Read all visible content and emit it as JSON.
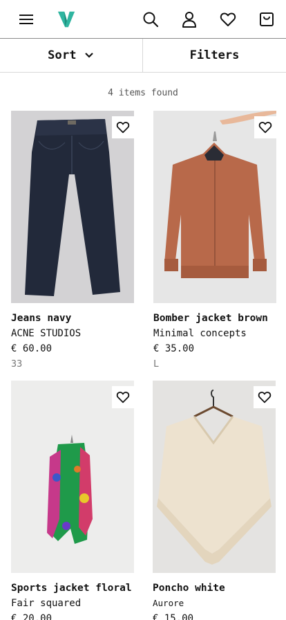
{
  "header": {
    "icons": [
      "menu-icon",
      "brand-logo",
      "search-icon",
      "user-icon",
      "heart-icon",
      "bag-icon"
    ],
    "accent": "#2fb5a0"
  },
  "toolbar": {
    "sort_label": "Sort",
    "filters_label": "Filters"
  },
  "results": {
    "count_text": "4 items found"
  },
  "products": [
    {
      "name": "Jeans navy",
      "brand": "ACNE STUDIOS",
      "price": "€ 60.00",
      "size": "33"
    },
    {
      "name": "Bomber jacket brown",
      "brand": "Minimal concepts",
      "price": "€ 35.00",
      "size": "L"
    },
    {
      "name": "Sports jacket floral",
      "brand": "Fair squared",
      "price": "€ 20.00",
      "size": ""
    },
    {
      "name": "Poncho white",
      "brand": "Aurore",
      "price": "€ 15.00",
      "size": ""
    }
  ]
}
